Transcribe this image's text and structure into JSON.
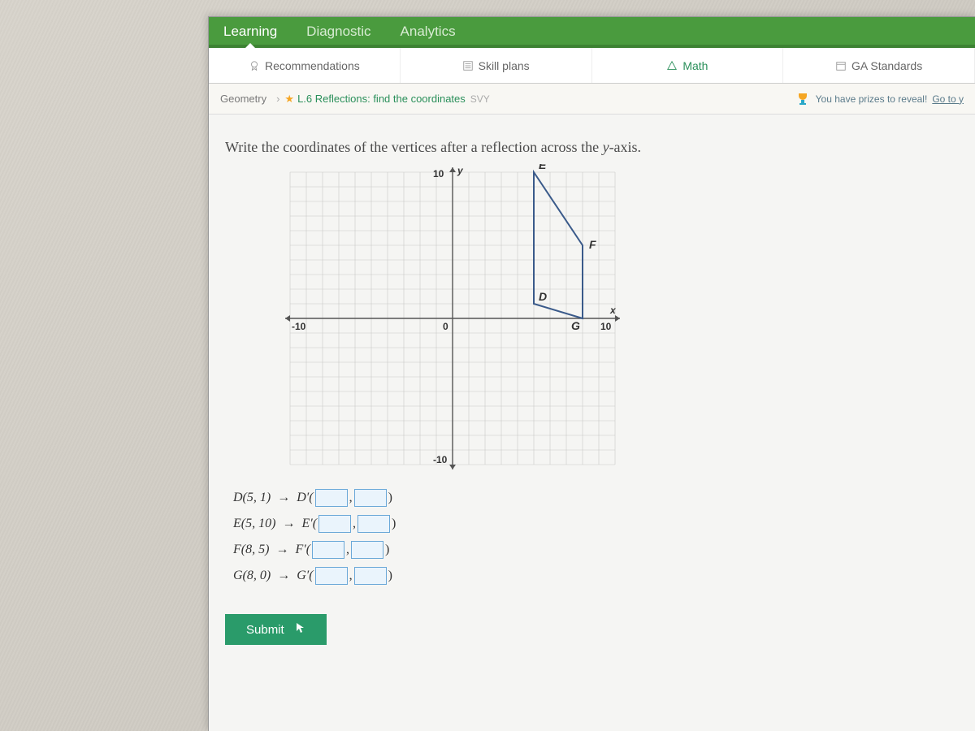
{
  "nav": {
    "primary": [
      "Learning",
      "Diagnostic",
      "Analytics"
    ],
    "active_primary": 0,
    "secondary": [
      {
        "label": "Recommendations",
        "icon": "medal-icon"
      },
      {
        "label": "Skill plans",
        "icon": "list-icon"
      },
      {
        "label": "Math",
        "icon": "triangle-icon",
        "highlight": true
      },
      {
        "label": "GA Standards",
        "icon": "calendar-icon"
      }
    ]
  },
  "breadcrumb": {
    "subject": "Geometry",
    "skill_code": "L.6",
    "skill_name": "Reflections: find the coordinates",
    "tag": "SVY"
  },
  "prize_text": "You have prizes to reveal!",
  "prize_link": "Go to y",
  "question_prefix": "Write the coordinates of the vertices after a reflection across the ",
  "question_axis": "y",
  "question_suffix": "-axis.",
  "chart_data": {
    "type": "scatter",
    "title": "",
    "xlabel": "x",
    "ylabel": "y",
    "xlim": [
      -10,
      10
    ],
    "ylim": [
      -10,
      10
    ],
    "grid": true,
    "series": [
      {
        "name": "quadrilateral DEFG",
        "points": [
          {
            "label": "D",
            "x": 5,
            "y": 1
          },
          {
            "label": "E",
            "x": 5,
            "y": 10
          },
          {
            "label": "F",
            "x": 8,
            "y": 5
          },
          {
            "label": "G",
            "x": 8,
            "y": 0
          }
        ],
        "closed": true,
        "color": "#3a5a8a"
      }
    ],
    "axis_ticks": {
      "neg10": "-10",
      "zero": "0",
      "ten": "10",
      "negten_y": "-10",
      "ten_y": "10"
    }
  },
  "answers": [
    {
      "orig_label": "D",
      "orig": "(5, 1)",
      "prime": "D′"
    },
    {
      "orig_label": "E",
      "orig": "(5, 10)",
      "prime": "E′"
    },
    {
      "orig_label": "F",
      "orig": "(8, 5)",
      "prime": "F′"
    },
    {
      "orig_label": "G",
      "orig": "(8, 0)",
      "prime": "G′"
    }
  ],
  "submit_label": "Submit"
}
